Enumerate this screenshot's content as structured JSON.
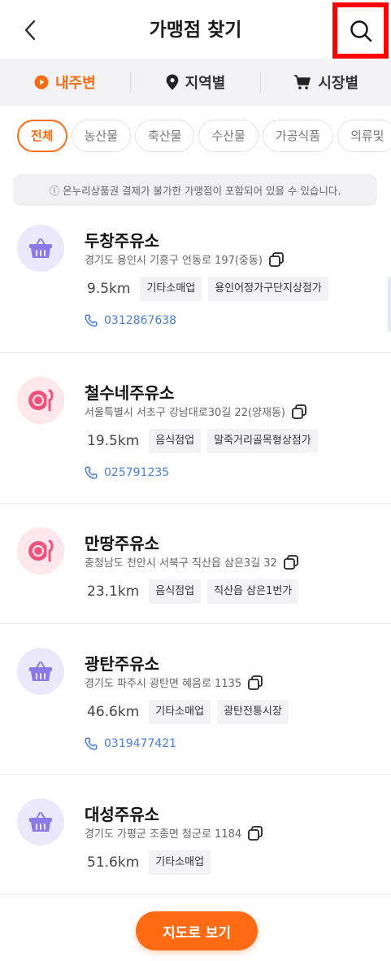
{
  "header": {
    "title": "가맹점 찾기"
  },
  "tabs": [
    {
      "label": "내주변",
      "icon": "play-circle-icon",
      "active": true
    },
    {
      "label": "지역별",
      "icon": "location-pin-icon",
      "active": false
    },
    {
      "label": "시장별",
      "icon": "cart-icon",
      "active": false
    }
  ],
  "categories": [
    {
      "label": "전체",
      "active": true
    },
    {
      "label": "농산물",
      "active": false
    },
    {
      "label": "축산물",
      "active": false
    },
    {
      "label": "수산물",
      "active": false
    },
    {
      "label": "가공식품",
      "active": false
    },
    {
      "label": "의류및",
      "active": false
    }
  ],
  "notice": "ⓘ 온누리상품권 결제가 불가한 가맹점이 포함되어 있을 수 있습니다.",
  "stores": [
    {
      "name": "두창주유소",
      "address": "경기도 용인시 기흥구 언동로 197(중동)",
      "distance": "9.5km",
      "tags": [
        "기타소매업",
        "용인어정가구단지상점가"
      ],
      "phone": "0312867638",
      "icon": "basket-icon"
    },
    {
      "name": "철수네주유소",
      "address": "서울특별시 서초구 강남대로30길 22(양재동)",
      "distance": "19.5km",
      "tags": [
        "음식점업",
        "말죽거리골목형상점가"
      ],
      "phone": "025791235",
      "icon": "dining-icon"
    },
    {
      "name": "만땅주유소",
      "address": "충청남도 천안시 서북구 직산읍 삼은3길 32",
      "distance": "23.1km",
      "tags": [
        "음식점업",
        "직산읍 삼은1번가"
      ],
      "phone": "",
      "icon": "dining-icon"
    },
    {
      "name": "광탄주유소",
      "address": "경기도 파주시 광탄면 혜음로 1135",
      "distance": "46.6km",
      "tags": [
        "기타소매업",
        "광탄전통시장"
      ],
      "phone": "0319477421",
      "icon": "basket-icon"
    },
    {
      "name": "대성주유소",
      "address": "경기도 가평군 조종면 청군로 1184",
      "distance": "51.6km",
      "tags": [
        "기타소매업"
      ],
      "phone": "",
      "icon": "basket-icon"
    }
  ],
  "map_button": "지도로 보기",
  "colors": {
    "accent": "#ff6a13",
    "phone": "#4a7fd8",
    "highlight_border": "#ff0000"
  }
}
